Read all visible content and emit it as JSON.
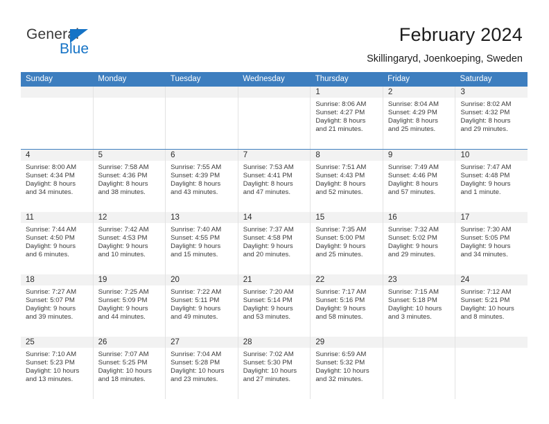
{
  "brand": {
    "name_top": "General",
    "name_bottom": "Blue",
    "accent_color": "#1573c6"
  },
  "header": {
    "title": "February 2024",
    "subtitle": "Skillingaryd, Joenkoeping, Sweden"
  },
  "calendar": {
    "header_bg": "#3d7ebf",
    "daynum_bg": "#f2f2f2",
    "weekdays": [
      "Sunday",
      "Monday",
      "Tuesday",
      "Wednesday",
      "Thursday",
      "Friday",
      "Saturday"
    ],
    "labels": {
      "sunrise": "Sunrise:",
      "sunset": "Sunset:",
      "daylight": "Daylight:"
    },
    "weeks": [
      [
        {
          "day": "",
          "empty": true
        },
        {
          "day": "",
          "empty": true
        },
        {
          "day": "",
          "empty": true
        },
        {
          "day": "",
          "empty": true
        },
        {
          "day": "1",
          "sunrise": "Sunrise: 8:06 AM",
          "sunset": "Sunset: 4:27 PM",
          "daylight1": "Daylight: 8 hours",
          "daylight2": "and 21 minutes."
        },
        {
          "day": "2",
          "sunrise": "Sunrise: 8:04 AM",
          "sunset": "Sunset: 4:29 PM",
          "daylight1": "Daylight: 8 hours",
          "daylight2": "and 25 minutes."
        },
        {
          "day": "3",
          "sunrise": "Sunrise: 8:02 AM",
          "sunset": "Sunset: 4:32 PM",
          "daylight1": "Daylight: 8 hours",
          "daylight2": "and 29 minutes."
        }
      ],
      [
        {
          "day": "4",
          "sunrise": "Sunrise: 8:00 AM",
          "sunset": "Sunset: 4:34 PM",
          "daylight1": "Daylight: 8 hours",
          "daylight2": "and 34 minutes."
        },
        {
          "day": "5",
          "sunrise": "Sunrise: 7:58 AM",
          "sunset": "Sunset: 4:36 PM",
          "daylight1": "Daylight: 8 hours",
          "daylight2": "and 38 minutes."
        },
        {
          "day": "6",
          "sunrise": "Sunrise: 7:55 AM",
          "sunset": "Sunset: 4:39 PM",
          "daylight1": "Daylight: 8 hours",
          "daylight2": "and 43 minutes."
        },
        {
          "day": "7",
          "sunrise": "Sunrise: 7:53 AM",
          "sunset": "Sunset: 4:41 PM",
          "daylight1": "Daylight: 8 hours",
          "daylight2": "and 47 minutes."
        },
        {
          "day": "8",
          "sunrise": "Sunrise: 7:51 AM",
          "sunset": "Sunset: 4:43 PM",
          "daylight1": "Daylight: 8 hours",
          "daylight2": "and 52 minutes."
        },
        {
          "day": "9",
          "sunrise": "Sunrise: 7:49 AM",
          "sunset": "Sunset: 4:46 PM",
          "daylight1": "Daylight: 8 hours",
          "daylight2": "and 57 minutes."
        },
        {
          "day": "10",
          "sunrise": "Sunrise: 7:47 AM",
          "sunset": "Sunset: 4:48 PM",
          "daylight1": "Daylight: 9 hours",
          "daylight2": "and 1 minute."
        }
      ],
      [
        {
          "day": "11",
          "sunrise": "Sunrise: 7:44 AM",
          "sunset": "Sunset: 4:50 PM",
          "daylight1": "Daylight: 9 hours",
          "daylight2": "and 6 minutes."
        },
        {
          "day": "12",
          "sunrise": "Sunrise: 7:42 AM",
          "sunset": "Sunset: 4:53 PM",
          "daylight1": "Daylight: 9 hours",
          "daylight2": "and 10 minutes."
        },
        {
          "day": "13",
          "sunrise": "Sunrise: 7:40 AM",
          "sunset": "Sunset: 4:55 PM",
          "daylight1": "Daylight: 9 hours",
          "daylight2": "and 15 minutes."
        },
        {
          "day": "14",
          "sunrise": "Sunrise: 7:37 AM",
          "sunset": "Sunset: 4:58 PM",
          "daylight1": "Daylight: 9 hours",
          "daylight2": "and 20 minutes."
        },
        {
          "day": "15",
          "sunrise": "Sunrise: 7:35 AM",
          "sunset": "Sunset: 5:00 PM",
          "daylight1": "Daylight: 9 hours",
          "daylight2": "and 25 minutes."
        },
        {
          "day": "16",
          "sunrise": "Sunrise: 7:32 AM",
          "sunset": "Sunset: 5:02 PM",
          "daylight1": "Daylight: 9 hours",
          "daylight2": "and 29 minutes."
        },
        {
          "day": "17",
          "sunrise": "Sunrise: 7:30 AM",
          "sunset": "Sunset: 5:05 PM",
          "daylight1": "Daylight: 9 hours",
          "daylight2": "and 34 minutes."
        }
      ],
      [
        {
          "day": "18",
          "sunrise": "Sunrise: 7:27 AM",
          "sunset": "Sunset: 5:07 PM",
          "daylight1": "Daylight: 9 hours",
          "daylight2": "and 39 minutes."
        },
        {
          "day": "19",
          "sunrise": "Sunrise: 7:25 AM",
          "sunset": "Sunset: 5:09 PM",
          "daylight1": "Daylight: 9 hours",
          "daylight2": "and 44 minutes."
        },
        {
          "day": "20",
          "sunrise": "Sunrise: 7:22 AM",
          "sunset": "Sunset: 5:11 PM",
          "daylight1": "Daylight: 9 hours",
          "daylight2": "and 49 minutes."
        },
        {
          "day": "21",
          "sunrise": "Sunrise: 7:20 AM",
          "sunset": "Sunset: 5:14 PM",
          "daylight1": "Daylight: 9 hours",
          "daylight2": "and 53 minutes."
        },
        {
          "day": "22",
          "sunrise": "Sunrise: 7:17 AM",
          "sunset": "Sunset: 5:16 PM",
          "daylight1": "Daylight: 9 hours",
          "daylight2": "and 58 minutes."
        },
        {
          "day": "23",
          "sunrise": "Sunrise: 7:15 AM",
          "sunset": "Sunset: 5:18 PM",
          "daylight1": "Daylight: 10 hours",
          "daylight2": "and 3 minutes."
        },
        {
          "day": "24",
          "sunrise": "Sunrise: 7:12 AM",
          "sunset": "Sunset: 5:21 PM",
          "daylight1": "Daylight: 10 hours",
          "daylight2": "and 8 minutes."
        }
      ],
      [
        {
          "day": "25",
          "sunrise": "Sunrise: 7:10 AM",
          "sunset": "Sunset: 5:23 PM",
          "daylight1": "Daylight: 10 hours",
          "daylight2": "and 13 minutes."
        },
        {
          "day": "26",
          "sunrise": "Sunrise: 7:07 AM",
          "sunset": "Sunset: 5:25 PM",
          "daylight1": "Daylight: 10 hours",
          "daylight2": "and 18 minutes."
        },
        {
          "day": "27",
          "sunrise": "Sunrise: 7:04 AM",
          "sunset": "Sunset: 5:28 PM",
          "daylight1": "Daylight: 10 hours",
          "daylight2": "and 23 minutes."
        },
        {
          "day": "28",
          "sunrise": "Sunrise: 7:02 AM",
          "sunset": "Sunset: 5:30 PM",
          "daylight1": "Daylight: 10 hours",
          "daylight2": "and 27 minutes."
        },
        {
          "day": "29",
          "sunrise": "Sunrise: 6:59 AM",
          "sunset": "Sunset: 5:32 PM",
          "daylight1": "Daylight: 10 hours",
          "daylight2": "and 32 minutes."
        },
        {
          "day": "",
          "empty": true
        },
        {
          "day": "",
          "empty": true
        }
      ]
    ]
  }
}
